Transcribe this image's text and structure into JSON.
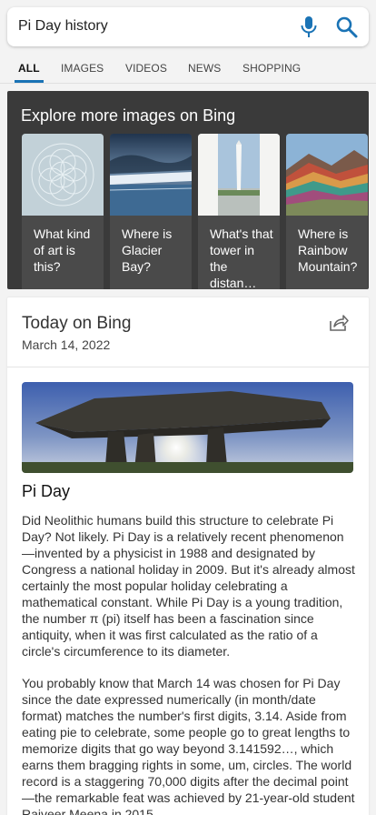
{
  "search": {
    "query": "Pi Day history"
  },
  "tabs": [
    {
      "label": "ALL",
      "active": true
    },
    {
      "label": "IMAGES"
    },
    {
      "label": "VIDEOS"
    },
    {
      "label": "NEWS"
    },
    {
      "label": "SHOPPING"
    }
  ],
  "explore": {
    "title": "Explore more images on Bing",
    "cards": [
      {
        "label": "What kind of art is this?"
      },
      {
        "label": "Where is Glacier Bay?"
      },
      {
        "label": "What's that tower in the distan…"
      },
      {
        "label": "Where is Rainbow Mountain?"
      }
    ]
  },
  "today": {
    "title": "Today on Bing",
    "date": "March 14, 2022",
    "article_title": "Pi Day",
    "paragraph1": "Did Neolithic humans build this structure to celebrate Pi Day? Not likely. Pi Day is a relatively recent phenomenon—invented by a physicist in 1988 and designated by Congress a national holiday in 2009. But it's already almost certainly the most popular holiday celebrating a mathematical constant. While Pi Day is a young tradition, the number π (pi) itself has been a fascination since antiquity, when it was first calculated as the ratio of a circle's circumference to its diameter.",
    "paragraph2": "You probably know that March 14 was chosen for Pi Day since the date expressed numerically (in month/date format) matches the number's first digits, 3.14. Aside from eating pie to celebrate, some people go to great lengths to memorize digits that go way beyond 3.141592…, which earns them bragging rights in some, um, circles. The world record is a staggering 70,000 digits after the decimal point—the remarkable feat was achieved by 21-year-old student Rajveer Meena in 2015."
  },
  "colors": {
    "accent": "#1a73b5",
    "explore_bg": "#3a3a3a"
  }
}
